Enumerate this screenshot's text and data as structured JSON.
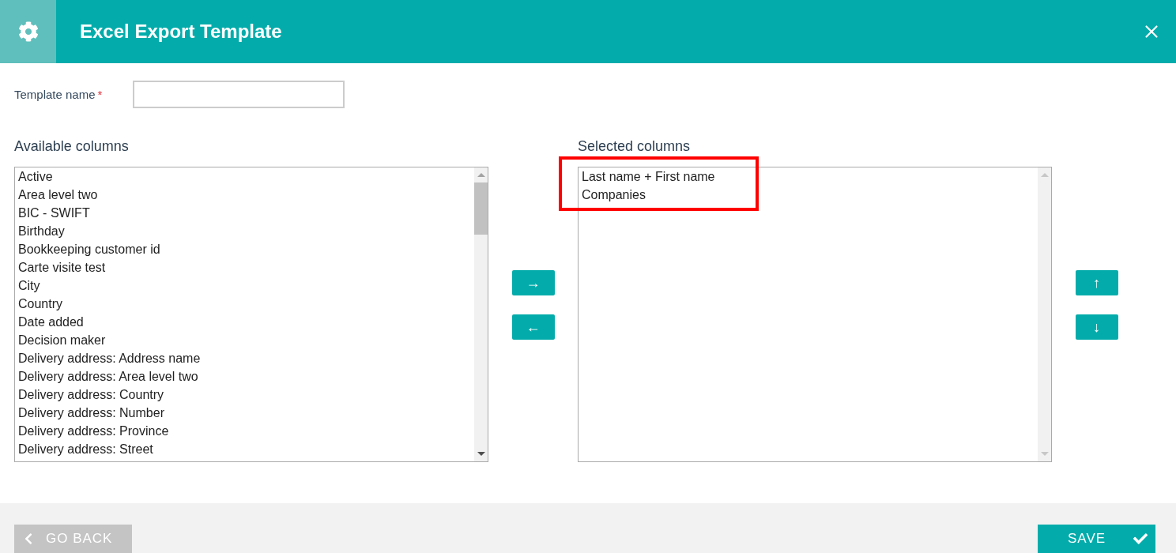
{
  "header": {
    "title": "Excel Export Template"
  },
  "template_name": {
    "label": "Template name",
    "required_mark": "*"
  },
  "available_columns": {
    "title": "Available columns",
    "items": [
      {
        "label": "Active",
        "selected": false
      },
      {
        "label": "Area level two",
        "selected": false
      },
      {
        "label": "BIC - SWIFT",
        "selected": false
      },
      {
        "label": "Birthday",
        "selected": false
      },
      {
        "label": "Bookkeeping customer id",
        "selected": false
      },
      {
        "label": "Carte visite test",
        "selected": false
      },
      {
        "label": "City",
        "selected": false
      },
      {
        "label": "Country",
        "selected": false
      },
      {
        "label": "Date added",
        "selected": false
      },
      {
        "label": "Decision maker",
        "selected": false
      },
      {
        "label": "Delivery address: Address name",
        "selected": false
      },
      {
        "label": "Delivery address: Area level two",
        "selected": false
      },
      {
        "label": "Delivery address: Country",
        "selected": false
      },
      {
        "label": "Delivery address: Number",
        "selected": false
      },
      {
        "label": "Delivery address: Province",
        "selected": false
      },
      {
        "label": "Delivery address: Street",
        "selected": false
      }
    ]
  },
  "move_buttons": [
    {
      "label": "→"
    },
    {
      "label": "←"
    }
  ],
  "selected_columns": {
    "title": "Selected columns",
    "highlighted": true,
    "items": [
      {
        "label": "Last name + First name",
        "selected": false
      },
      {
        "label": "Companies",
        "selected": false
      }
    ]
  },
  "order_buttons": [
    {
      "label": "↑"
    },
    {
      "label": "↓"
    }
  ],
  "footer": {
    "back": "GO BACK",
    "save": "SAVE"
  }
}
